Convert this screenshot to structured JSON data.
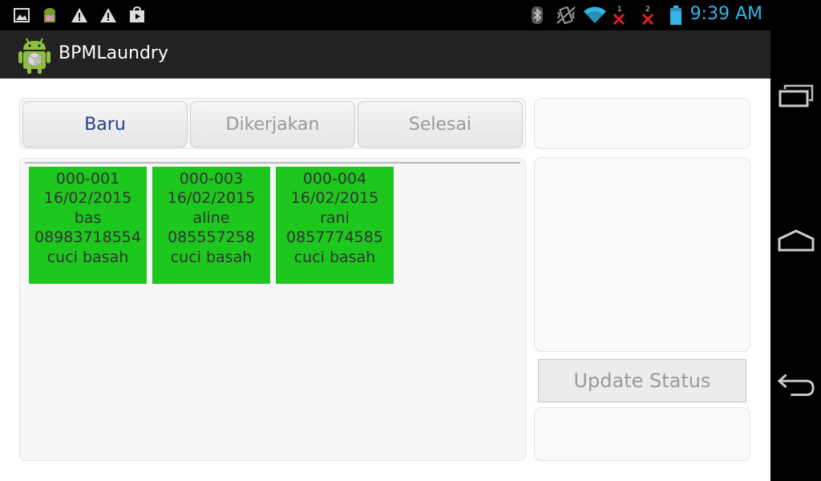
{
  "status_bar": {
    "time": "9:39 AM",
    "left_icons": [
      "gallery-icon",
      "android-debug-icon",
      "warning-icon",
      "warning-icon",
      "play-store-icon"
    ],
    "right_icons": [
      "bluetooth-icon",
      "vibrate-icon",
      "wifi-icon",
      "sim1-no-signal-icon",
      "sim2-no-signal-icon",
      "battery-icon"
    ],
    "sim1_label": "1",
    "sim2_label": "2"
  },
  "app": {
    "title": "BPMLaundry",
    "logo_icon": "android-box-logo-icon"
  },
  "tabs": [
    {
      "label": "Baru",
      "active": true
    },
    {
      "label": "Dikerjakan",
      "active": false
    },
    {
      "label": "Selesai",
      "active": false
    }
  ],
  "orders": [
    {
      "code": "000-001",
      "date": "16/02/2015",
      "name": "bas",
      "phone": "08983718554",
      "service": "cuci basah"
    },
    {
      "code": "000-003",
      "date": "16/02/2015",
      "name": "aline",
      "phone": "085557258",
      "service": "cuci basah"
    },
    {
      "code": "000-004",
      "date": "16/02/2015",
      "name": "rani",
      "phone": "0857774585",
      "service": "cuci basah"
    }
  ],
  "right_panel": {
    "update_button": "Update Status"
  },
  "colors": {
    "card": "#1ec71e",
    "clock": "#33b5e5",
    "active_tab": "#22408a",
    "action_bar": "#222222"
  },
  "nav_bar": [
    "recent-apps-icon",
    "home-icon",
    "back-icon"
  ]
}
